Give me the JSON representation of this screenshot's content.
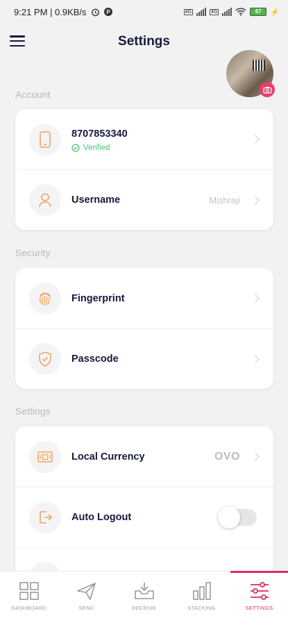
{
  "status_bar": {
    "time_speed": "9:21 PM | 0.9KB/s",
    "battery": "67"
  },
  "header": {
    "title": "Settings"
  },
  "sections": {
    "account": "Account",
    "security": "Security",
    "settings": "Settings"
  },
  "account": {
    "phone": {
      "label": "8707853340",
      "status": "Verified"
    },
    "username": {
      "label": "Username",
      "value": "Mishraji"
    }
  },
  "security": {
    "fingerprint": {
      "label": "Fingerprint"
    },
    "passcode": {
      "label": "Passcode"
    }
  },
  "settings": {
    "currency": {
      "label": "Local Currency",
      "value": "OVO"
    },
    "auto_logout": {
      "label": "Auto Logout",
      "enabled": false
    }
  },
  "nav": [
    {
      "label": "DASHBOARD",
      "icon": "dashboard-icon"
    },
    {
      "label": "SEND",
      "icon": "send-icon"
    },
    {
      "label": "RECEIVE",
      "icon": "receive-icon"
    },
    {
      "label": "STACKING",
      "icon": "stacking-icon"
    },
    {
      "label": "SETTINGS",
      "icon": "settings-sliders-icon",
      "active": true
    }
  ],
  "colors": {
    "accent": "#e02a5b",
    "icon_orange": "#f0a35a",
    "verified_green": "#4cc07a",
    "title_navy": "#14193f"
  }
}
